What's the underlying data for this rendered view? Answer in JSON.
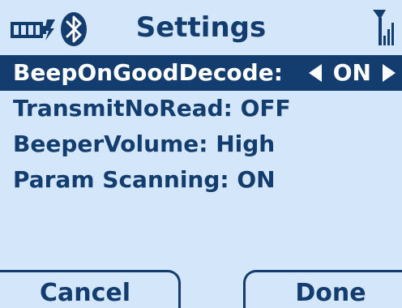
{
  "header": {
    "title": "Settings",
    "battery_icon": "battery-full-charging-icon",
    "bluetooth_icon": "bluetooth-icon",
    "signal_icon": "signal-strength-icon"
  },
  "settings": [
    {
      "label": "BeepOnGoodDecode:",
      "value": "ON",
      "selected": true
    },
    {
      "label": "TransmitNoRead:",
      "value": "OFF",
      "selected": false
    },
    {
      "label": "BeeperVolume:",
      "value": "High",
      "selected": false
    },
    {
      "label": "Param Scanning:",
      "value": "ON",
      "selected": false
    }
  ],
  "softkeys": {
    "left": "Cancel",
    "right": "Done"
  },
  "colors": {
    "background": "#d4e6fa",
    "text": "#123d6e",
    "highlight": "#123d6e",
    "highlight_text": "#ffffff"
  }
}
